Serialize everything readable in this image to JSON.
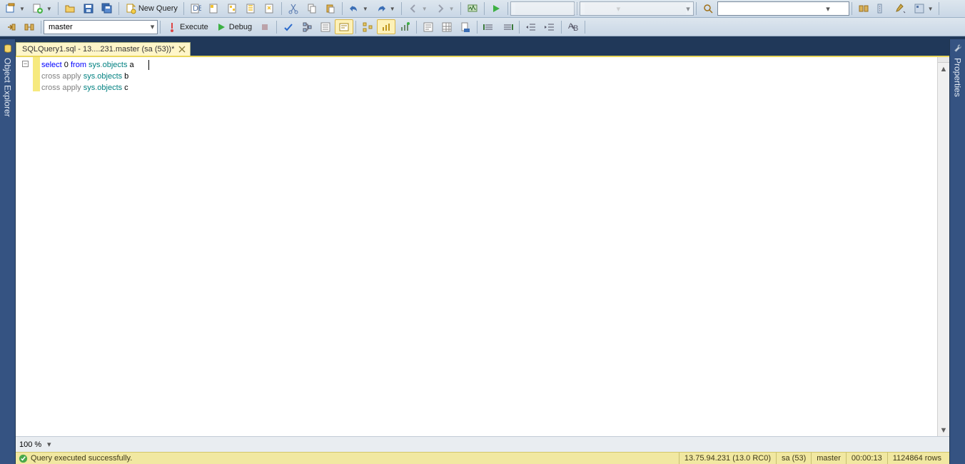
{
  "toolbar1": {
    "newquery": "New Query"
  },
  "toolbar2": {
    "db": "master",
    "execute": "Execute",
    "debug": "Debug"
  },
  "panels": {
    "left": "Object Explorer",
    "right": "Properties"
  },
  "tab": {
    "title": "SQLQuery1.sql - 13....231.master (sa (53))*"
  },
  "code": {
    "l1a": "select",
    "l1b": " 0 ",
    "l1c": "from",
    "l1d": " sys",
    "l1e": ".",
    "l1f": "objects",
    "l1g": " a",
    "l2a": "cross",
    "l2b": " apply",
    "l2c": " sys",
    "l2d": ".",
    "l2e": "objects",
    "l2f": " b",
    "l3a": "cross",
    "l3b": " apply",
    "l3c": " sys",
    "l3d": ".",
    "l3e": "objects",
    "l3f": " c"
  },
  "zoom": "100 %",
  "status": {
    "msg": "Query executed successfully.",
    "server": "13.75.94.231 (13.0 RC0)",
    "login": "sa (53)",
    "db": "master",
    "elapsed": "00:00:13",
    "rows": "1124864 rows"
  }
}
